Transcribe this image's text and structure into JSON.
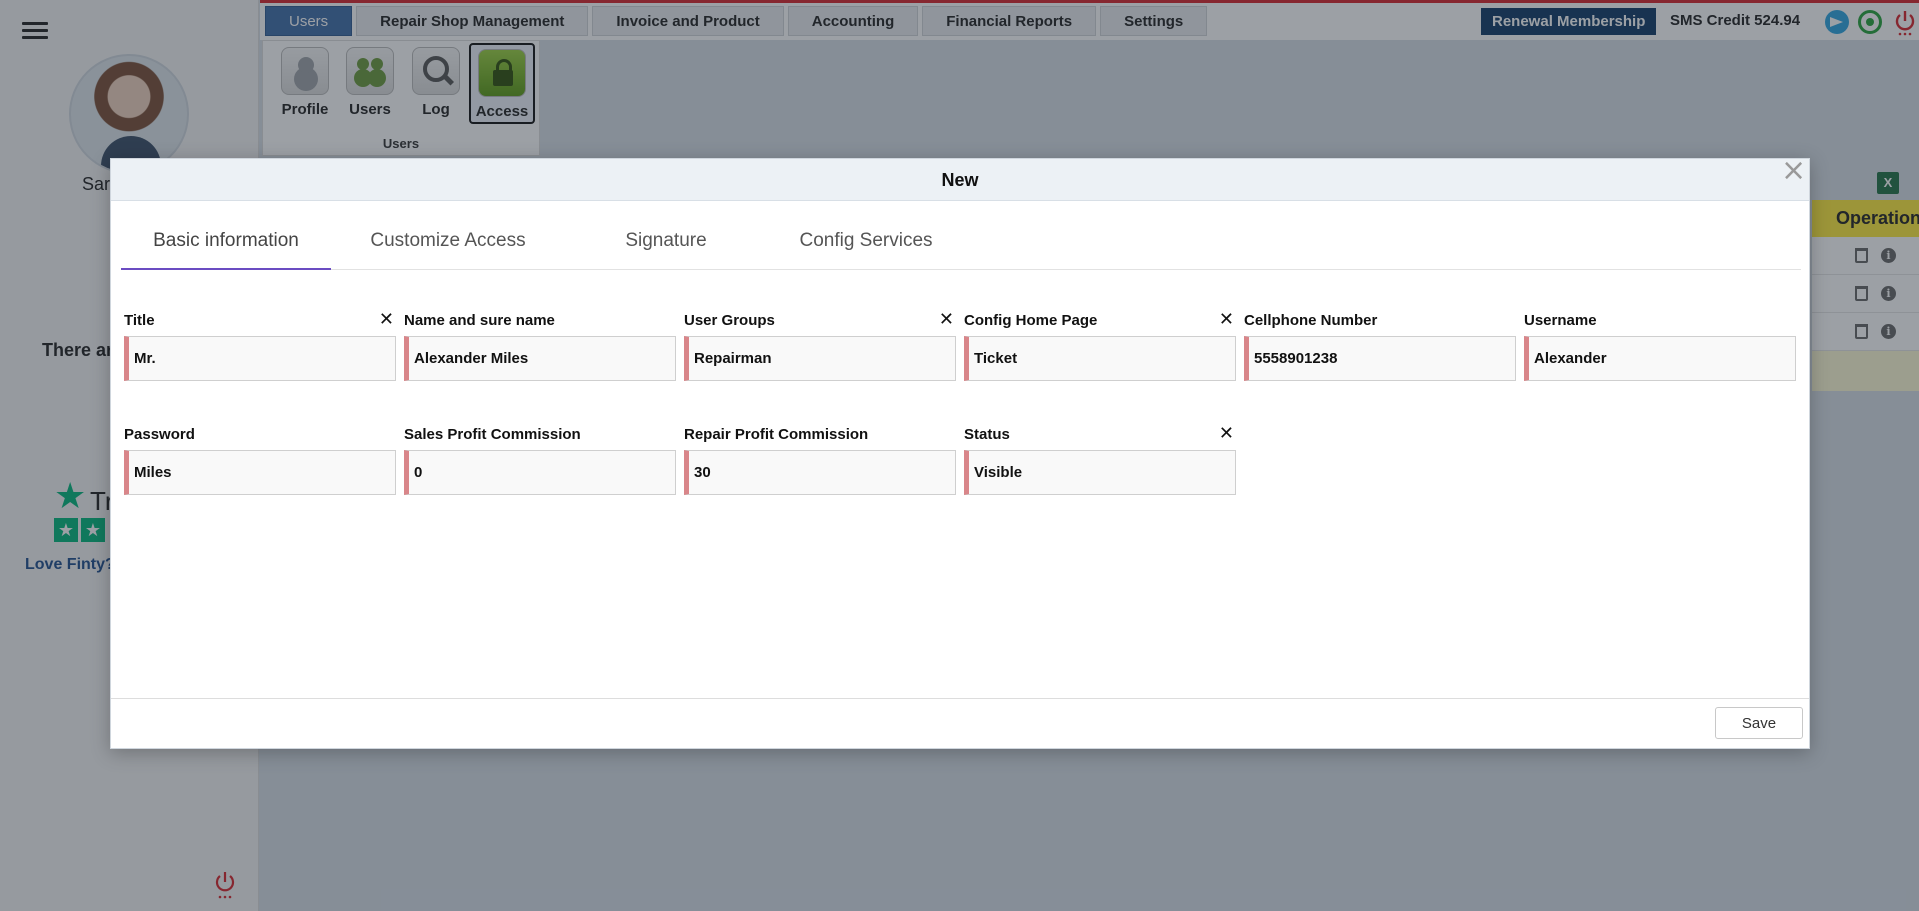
{
  "left_panel": {
    "user_name": "Sar",
    "notice_text": "There ar",
    "trustpilot_word": "Tr",
    "trustpilot_star": "★",
    "love_link": "Love Finty?"
  },
  "topbar": {
    "tabs": [
      "Users",
      "Repair Shop Management",
      "Invoice and Product",
      "Accounting",
      "Financial Reports",
      "Settings"
    ],
    "renewal": "Renewal Membership",
    "sms_credit": "SMS Credit 524.94"
  },
  "ribbon": {
    "buttons": [
      "Profile",
      "Users",
      "Log",
      "Access"
    ],
    "group_label": "Users"
  },
  "bg_table": {
    "header": "Operation",
    "info_glyph": "i",
    "excel_glyph": "X"
  },
  "modal": {
    "title": "New",
    "close_glyph": "×",
    "tabs": [
      "Basic information",
      "Customize Access",
      "Signature",
      "Config Services"
    ],
    "clear_glyph": "✕",
    "fields": [
      {
        "label": "Title",
        "value": "Mr."
      },
      {
        "label": "Name and sure name",
        "value": "Alexander Miles"
      },
      {
        "label": "User Groups",
        "value": "Repairman"
      },
      {
        "label": "Config Home Page",
        "value": "Ticket"
      },
      {
        "label": "Cellphone Number",
        "value": "5558901238"
      },
      {
        "label": "Username",
        "value": "Alexander"
      },
      {
        "label": "Password",
        "value": "Miles"
      },
      {
        "label": "Sales Profit Commission",
        "value": "0"
      },
      {
        "label": "Repair Profit Commission",
        "value": "30"
      },
      {
        "label": "Status",
        "value": "Visible"
      }
    ],
    "save_label": "Save"
  },
  "colors": {
    "active_tab": "#3e6da8",
    "renewal_bg": "#0f3a66",
    "required_marker": "#d9868a",
    "tab_underline": "#6b4cc2",
    "operation_header": "#ffeb3b"
  }
}
